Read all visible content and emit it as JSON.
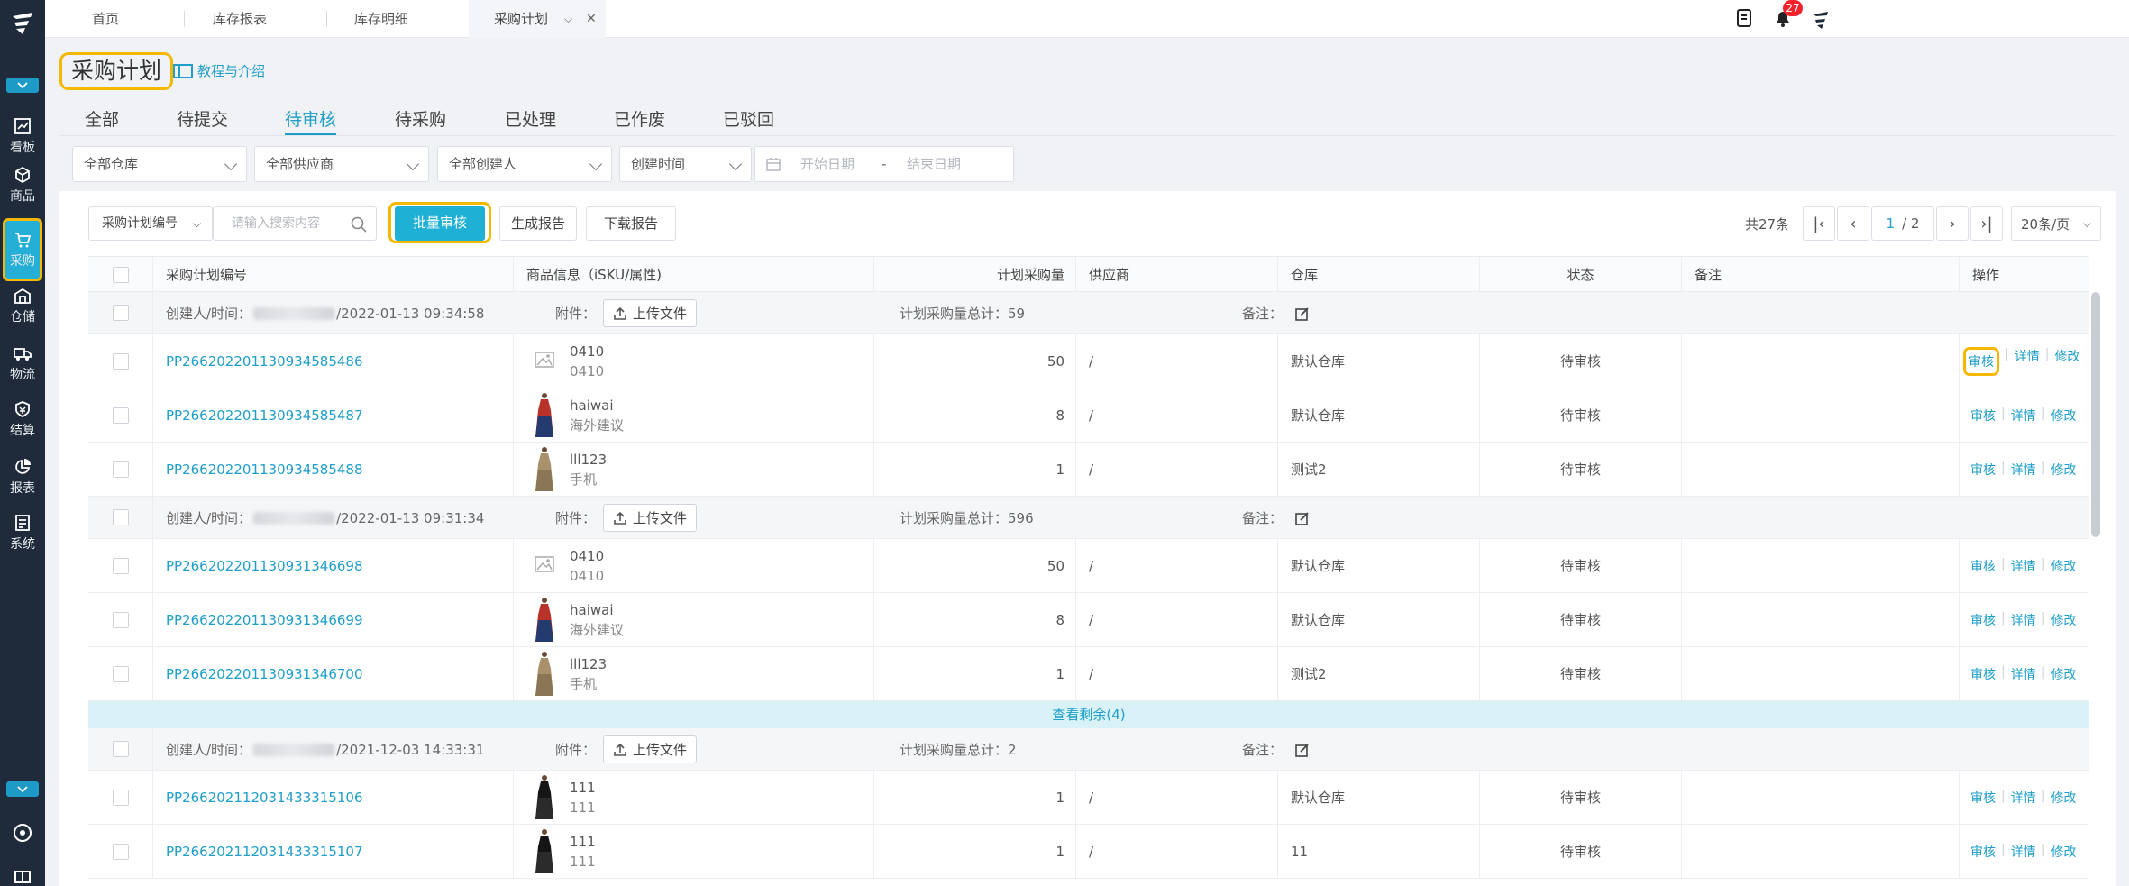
{
  "top_tabs": [
    "首页",
    "库存报表",
    "库存明细",
    "采购计划"
  ],
  "notification_count": "27",
  "sidebar": [
    {
      "label": "看板",
      "icon": "chart-icon"
    },
    {
      "label": "商品",
      "icon": "cube-icon"
    },
    {
      "label": "采购",
      "icon": "cart-icon"
    },
    {
      "label": "仓储",
      "icon": "warehouse-icon"
    },
    {
      "label": "物流",
      "icon": "truck-icon"
    },
    {
      "label": "结算",
      "icon": "money-icon"
    },
    {
      "label": "报表",
      "icon": "pie-icon"
    },
    {
      "label": "系统",
      "icon": "system-icon"
    }
  ],
  "page": {
    "title": "采购计划",
    "tutorial": "教程与介绍"
  },
  "status_tabs": [
    "全部",
    "待提交",
    "待审核",
    "待采购",
    "已处理",
    "已作废",
    "已驳回"
  ],
  "active_status_tab": "待审核",
  "filters": {
    "warehouse": "全部仓库",
    "supplier": "全部供应商",
    "creator": "全部创建人",
    "time_type": "创建时间",
    "start_placeholder": "开始日期",
    "date_sep": "-",
    "end_placeholder": "结束日期"
  },
  "toolbar": {
    "search_field": "采购计划编号",
    "search_placeholder": "请输入搜索内容",
    "batch_audit": "批量审核",
    "gen_report": "生成报告",
    "download_report": "下载报告"
  },
  "pager": {
    "total": "共27条",
    "page": "1",
    "pages": "/ 2",
    "page_size": "20条/页"
  },
  "columns": [
    "采购计划编号",
    "商品信息（iSKU/属性)",
    "计划采购量",
    "供应商",
    "仓库",
    "状态",
    "备注",
    "操作"
  ],
  "group_labels": {
    "creator": "创建人/时间：",
    "attach": "附件：",
    "upload": "上传文件",
    "total": "计划采购量总计：",
    "remark": "备注："
  },
  "ops": {
    "audit": "审核",
    "detail": "详情",
    "edit": "修改"
  },
  "groups": [
    {
      "time": "/2022-01-13 09:34:58",
      "total": "59",
      "items": [
        {
          "code": "PP266202201130934585486",
          "sku": "0410",
          "attr": "0410",
          "qty": "50",
          "supplier": "/",
          "warehouse": "默认仓库",
          "status": "待审核",
          "img": "placeholder"
        },
        {
          "code": "PP266202201130934585487",
          "sku": "haiwai",
          "attr": "海外建议",
          "qty": "8",
          "supplier": "/",
          "warehouse": "默认仓库",
          "status": "待审核",
          "img": "dress-red"
        },
        {
          "code": "PP266202201130934585488",
          "sku": "lll123",
          "attr": "手机",
          "qty": "1",
          "supplier": "/",
          "warehouse": "测试2",
          "status": "待审核",
          "img": "dress-khaki"
        }
      ]
    },
    {
      "time": "/2022-01-13 09:31:34",
      "total": "596",
      "items": [
        {
          "code": "PP266202201130931346698",
          "sku": "0410",
          "attr": "0410",
          "qty": "50",
          "supplier": "/",
          "warehouse": "默认仓库",
          "status": "待审核",
          "img": "placeholder"
        },
        {
          "code": "PP266202201130931346699",
          "sku": "haiwai",
          "attr": "海外建议",
          "qty": "8",
          "supplier": "/",
          "warehouse": "默认仓库",
          "status": "待审核",
          "img": "dress-red"
        },
        {
          "code": "PP266202201130931346700",
          "sku": "lll123",
          "attr": "手机",
          "qty": "1",
          "supplier": "/",
          "warehouse": "测试2",
          "status": "待审核",
          "img": "dress-khaki"
        }
      ]
    },
    {
      "time": "/2021-12-03 14:33:31",
      "total": "2",
      "items": [
        {
          "code": "PP266202112031433315106",
          "sku": "111",
          "attr": "111",
          "qty": "1",
          "supplier": "/",
          "warehouse": "默认仓库",
          "status": "待审核",
          "img": "dress-black"
        },
        {
          "code": "PP266202112031433315107",
          "sku": "111",
          "attr": "111",
          "qty": "1",
          "supplier": "/",
          "warehouse": "11",
          "status": "待审核",
          "img": "dress-black"
        }
      ]
    }
  ],
  "show_more": "查看剩余(4)"
}
